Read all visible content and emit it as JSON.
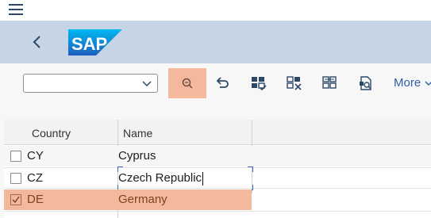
{
  "menubar": {
    "menu_icon": "hamburger-icon"
  },
  "shell": {
    "back_icon": "chevron-left-icon",
    "logo_text": "SAP",
    "brand_color": "#0a6ed1"
  },
  "toolbar": {
    "variant_value": "",
    "search_icon": "search-icon",
    "undo_icon": "undo-icon",
    "select_all_icon": "select-all-icon",
    "deselect_icon": "deselect-icon",
    "select_block_icon": "select-block-icon",
    "print_icon": "print-preview-icon",
    "more_label": "More"
  },
  "table": {
    "columns": [
      "Country",
      "Name"
    ],
    "rows": [
      {
        "country": "CY",
        "name": "Cyprus",
        "selected": false
      },
      {
        "country": "CZ",
        "name": "Czech Republic",
        "selected": false
      },
      {
        "country": "DE",
        "name": "Germany",
        "selected": true
      }
    ]
  }
}
